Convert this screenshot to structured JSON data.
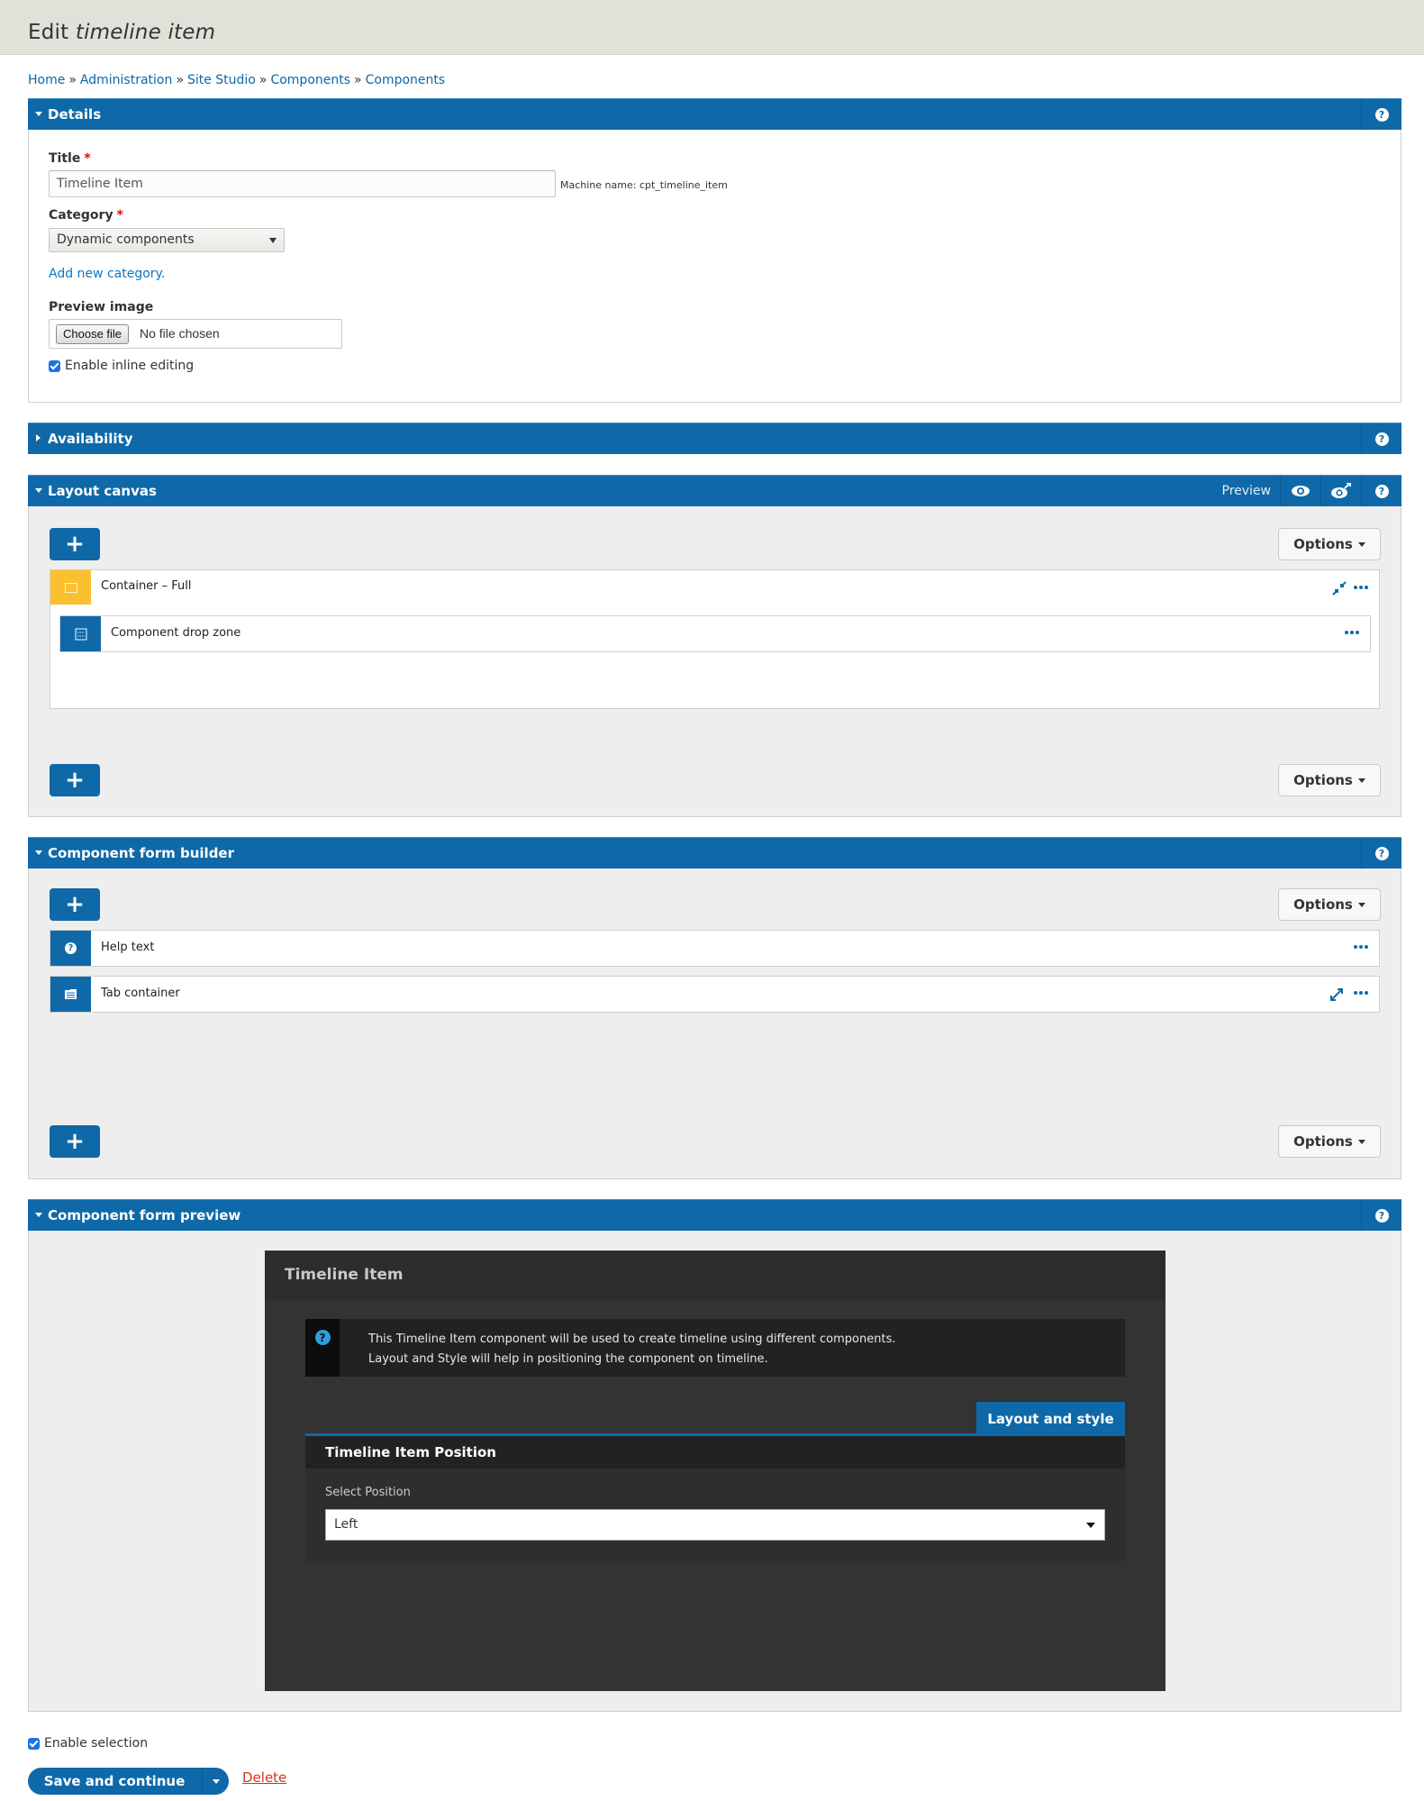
{
  "page": {
    "title_prefix": "Edit",
    "title_italic": "timeline item"
  },
  "breadcrumb": [
    {
      "label": "Home"
    },
    {
      "label": "Administration"
    },
    {
      "label": "Site Studio"
    },
    {
      "label": "Components"
    },
    {
      "label": "Components"
    }
  ],
  "breadcrumb_separator": "»",
  "colors": {
    "accent": "#0f69a8",
    "header_bg": "#e1e0d9",
    "container_yellow": "#fbc02d",
    "dark_panel": "#333333",
    "danger": "#d4351c"
  },
  "details": {
    "heading": "Details",
    "help_icon": "question-circle-icon",
    "title_label": "Title",
    "title_value": "Timeline Item",
    "required_mark": "*",
    "machine_name": "Machine name: cpt_timeline_item",
    "category_label": "Category",
    "category_value": "Dynamic components",
    "add_category_link": "Add new category.",
    "preview_image_label": "Preview image",
    "choose_file_label": "Choose file",
    "no_file_label": "No file chosen",
    "inline_editing_label": "Enable inline editing",
    "inline_editing_checked": true
  },
  "availability": {
    "heading": "Availability",
    "collapsed": true
  },
  "layout_canvas": {
    "heading": "Layout canvas",
    "preview_label": "Preview",
    "add_icon": "+",
    "options_label": "Options",
    "items": [
      {
        "label": "Container – Full",
        "icon": "container-icon",
        "actions": [
          "collapse-icon",
          "more-icon"
        ]
      },
      {
        "label": "Component drop zone",
        "icon": "drop-zone-icon",
        "actions": [
          "more-icon"
        ]
      }
    ]
  },
  "form_builder": {
    "heading": "Component form builder",
    "add_icon": "+",
    "options_label": "Options",
    "items": [
      {
        "label": "Help text",
        "icon": "question-circle-icon",
        "actions": [
          "more-icon"
        ]
      },
      {
        "label": "Tab container",
        "icon": "tab-container-icon",
        "actions": [
          "expand-icon",
          "more-icon"
        ]
      }
    ]
  },
  "form_preview": {
    "heading": "Component form preview",
    "panel_title": "Timeline Item",
    "help_line1": "This Timeline Item component will be used to create timeline using different components.",
    "help_line2": "Layout and Style will help in positioning the component on timeline.",
    "tab_label": "Layout and style",
    "group_title": "Timeline Item Position",
    "select_label": "Select Position",
    "select_value": "Left"
  },
  "footer": {
    "enable_selection_label": "Enable selection",
    "enable_selection_checked": true,
    "save_label": "Save and continue",
    "delete_label": "Delete"
  }
}
